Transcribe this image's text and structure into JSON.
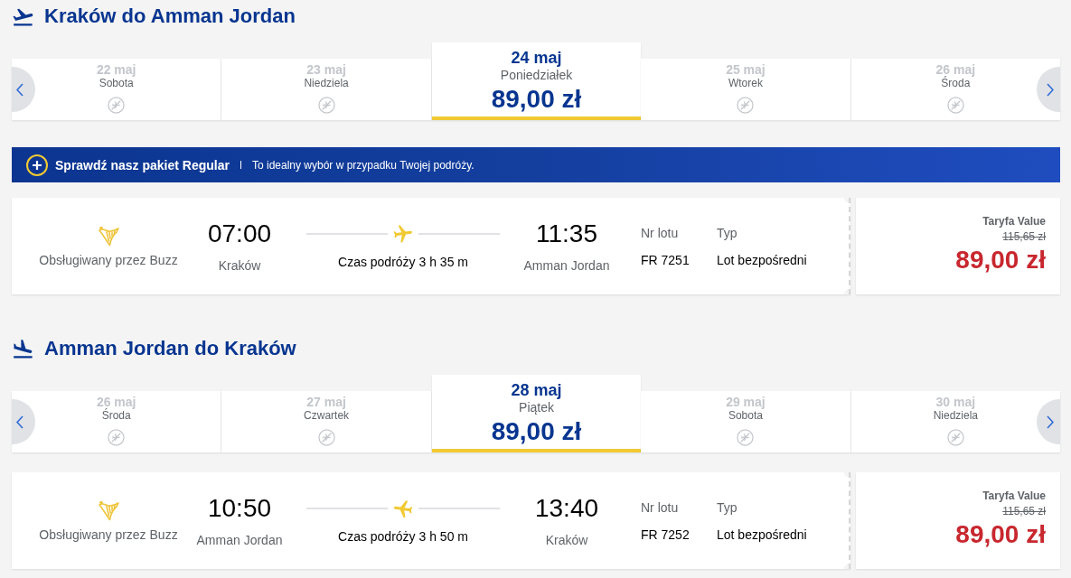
{
  "journeys": [
    {
      "kind": "outbound",
      "title": "Kraków do Amman Jordan",
      "days": [
        {
          "date": "22 maj",
          "weekday": "Sobota",
          "selected": false,
          "available": false
        },
        {
          "date": "23 maj",
          "weekday": "Niedziela",
          "selected": false,
          "available": false
        },
        {
          "date": "24 maj",
          "weekday": "Poniedziałek",
          "selected": true,
          "available": true,
          "price": "89,00 zł"
        },
        {
          "date": "25 maj",
          "weekday": "Wtorek",
          "selected": false,
          "available": false
        },
        {
          "date": "26 maj",
          "weekday": "Środa",
          "selected": false,
          "available": false
        }
      ],
      "promo": {
        "title": "Sprawdź nasz pakiet Regular",
        "text": "To idealny wybór w przypadku Twojej podróży."
      },
      "flight": {
        "operator": "Obsługiwany przez Buzz",
        "departure": {
          "time": "07:00",
          "city": "Kraków"
        },
        "duration": "Czas podróży 3 h 35 m",
        "arrival": {
          "time": "11:35",
          "city": "Amman Jordan"
        },
        "flight_number": {
          "label": "Nr lotu",
          "value": "FR 7251"
        },
        "type": {
          "label": "Typ",
          "value": "Lot bezpośredni"
        },
        "fare": {
          "label": "Taryfa Value",
          "old_price": "115,65 zł",
          "price": "89,00 zł"
        }
      }
    },
    {
      "kind": "return",
      "title": "Amman Jordan do Kraków",
      "days": [
        {
          "date": "26 maj",
          "weekday": "Środa",
          "selected": false,
          "available": false
        },
        {
          "date": "27 maj",
          "weekday": "Czwartek",
          "selected": false,
          "available": false
        },
        {
          "date": "28 maj",
          "weekday": "Piątek",
          "selected": true,
          "available": true,
          "price": "89,00 zł"
        },
        {
          "date": "29 maj",
          "weekday": "Sobota",
          "selected": false,
          "available": false
        },
        {
          "date": "30 maj",
          "weekday": "Niedziela",
          "selected": false,
          "available": false
        }
      ],
      "flight": {
        "operator": "Obsługiwany przez Buzz",
        "departure": {
          "time": "10:50",
          "city": "Amman Jordan"
        },
        "duration": "Czas podróży 3 h 50 m",
        "arrival": {
          "time": "13:40",
          "city": "Kraków"
        },
        "flight_number": {
          "label": "Nr lotu",
          "value": "FR 7252"
        },
        "type": {
          "label": "Typ",
          "value": "Lot bezpośredni"
        },
        "fare": {
          "label": "Taryfa Value",
          "old_price": "115,65 zł",
          "price": "89,00 zł"
        }
      }
    }
  ]
}
